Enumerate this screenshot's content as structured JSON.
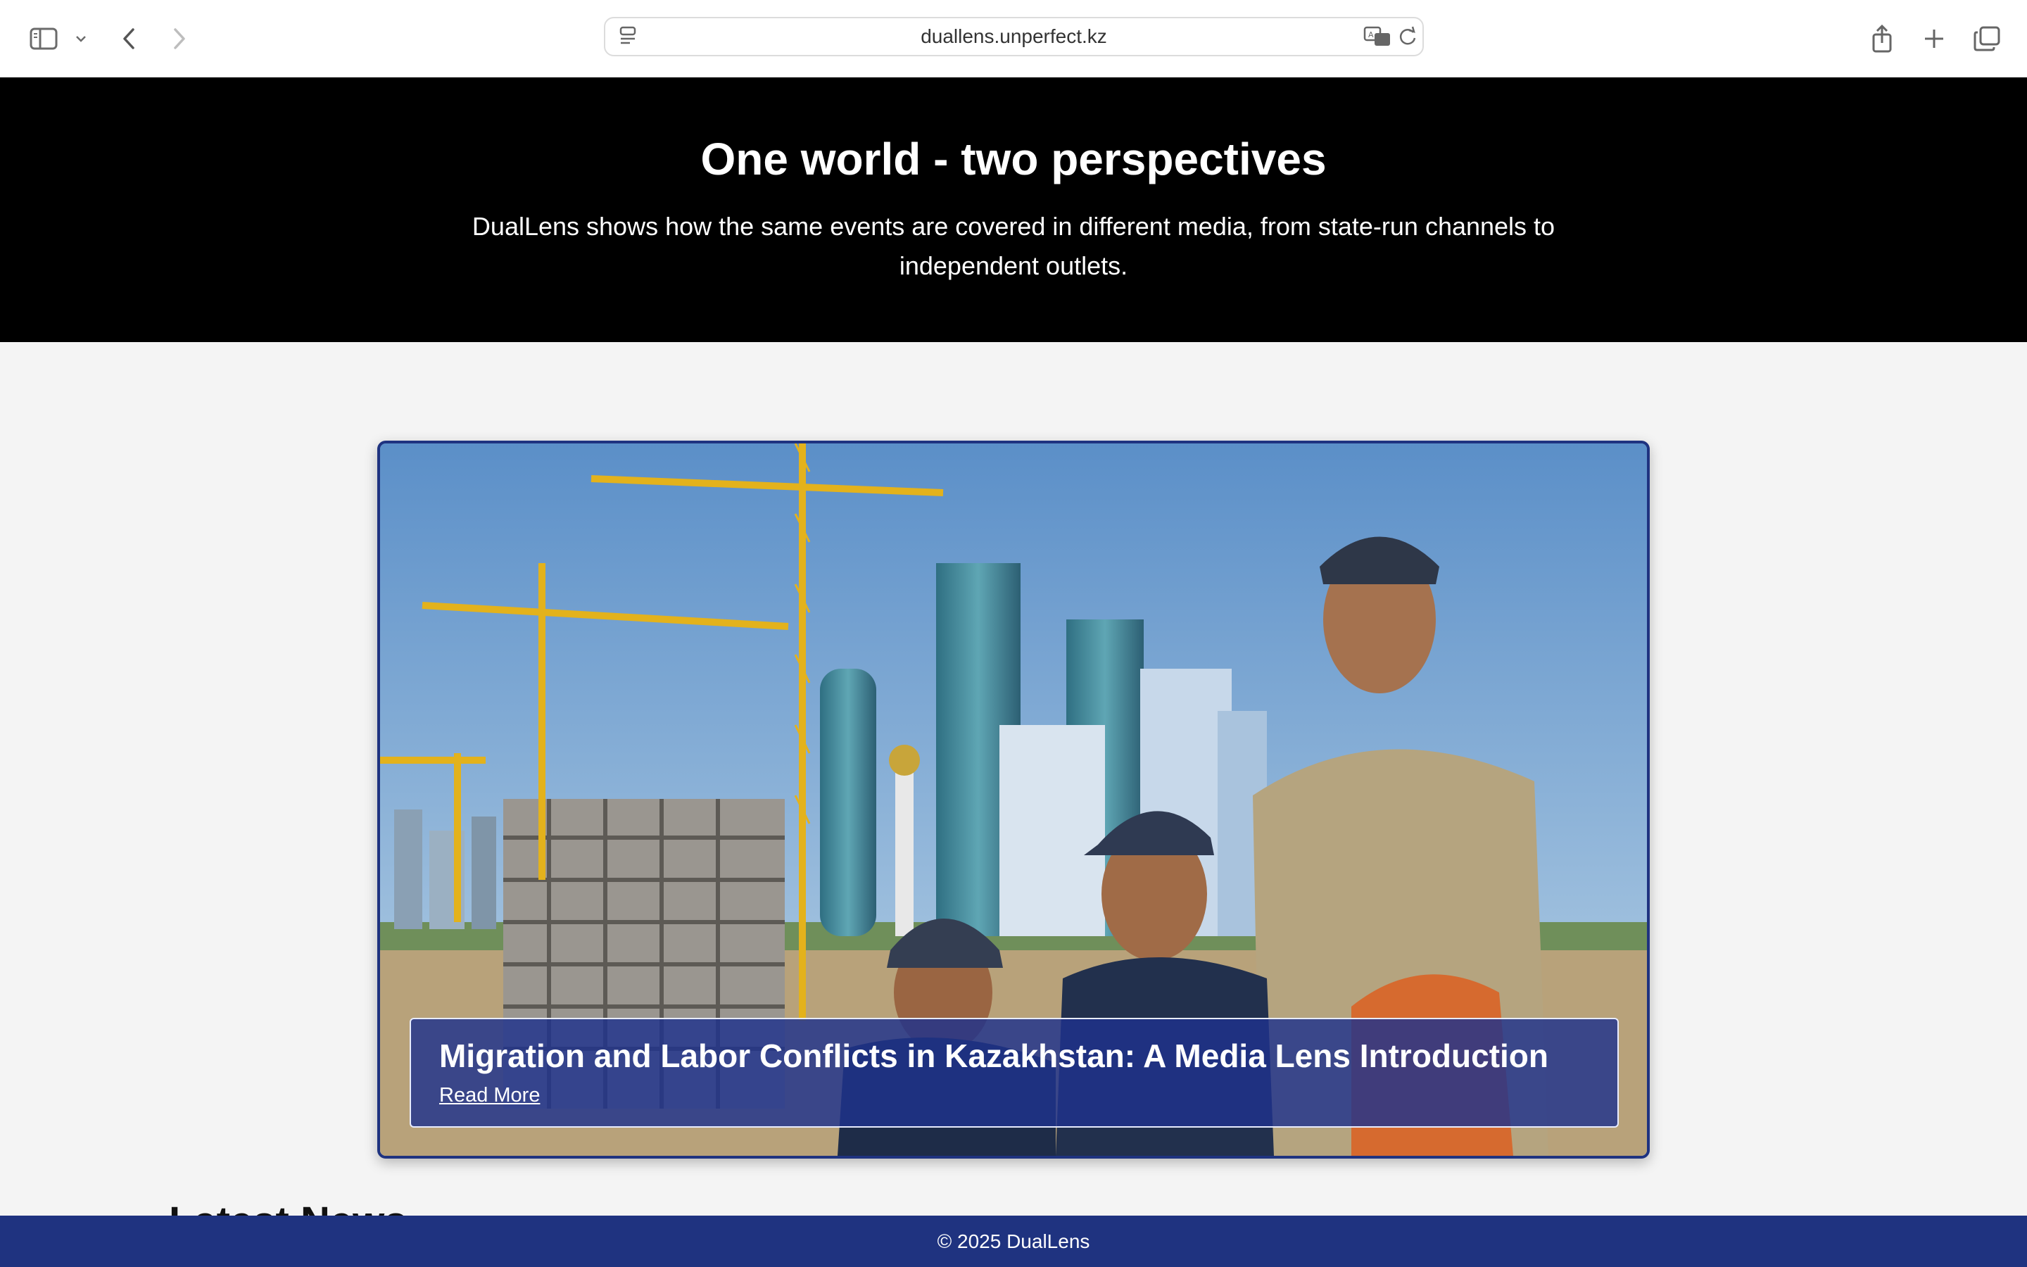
{
  "browser": {
    "url": "duallens.unperfect.kz",
    "icons": {
      "sidebar": "sidebar-icon",
      "dropdown": "chevron-down-icon",
      "back": "chevron-left-icon",
      "forward": "chevron-right-icon",
      "page_menu": "page-settings-icon",
      "translate": "translate-icon",
      "reload": "reload-icon",
      "share": "share-icon",
      "new_tab": "plus-icon",
      "tabs": "tabs-overview-icon"
    }
  },
  "hero": {
    "title": "One world - two perspectives",
    "subtitle": "DualLens shows how the same events are covered in different media, from state-run channels to independent outlets."
  },
  "featured": {
    "title": "Migration and Labor Conflicts in Kazakhstan: A Media Lens Introduction",
    "link_label": "Read More"
  },
  "section": {
    "heading": "Latest News"
  },
  "footer": {
    "text": "© 2025 DualLens"
  },
  "colors": {
    "hero_bg": "#000000",
    "accent": "#1f3380",
    "page_bg": "#f4f4f4"
  }
}
